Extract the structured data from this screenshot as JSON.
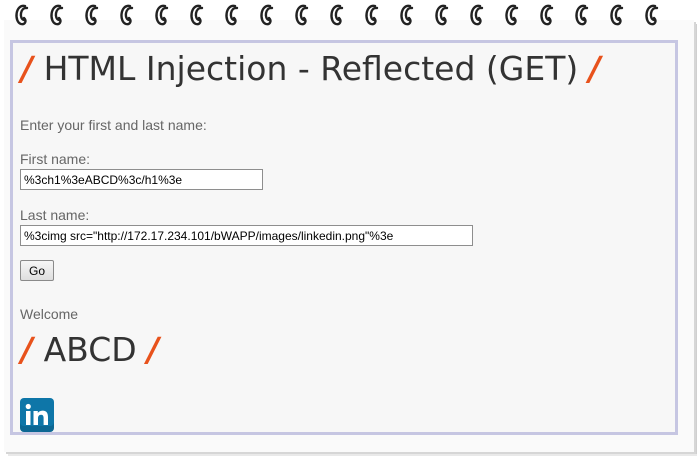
{
  "page": {
    "title": "HTML Injection - Reflected (GET)",
    "title_decor": "/"
  },
  "form": {
    "prompt": "Enter your first and last name:",
    "first_name_label": "First name:",
    "first_name_value": "%3ch1%3eABCD%3c/h1%3e",
    "last_name_label": "Last name:",
    "last_name_value": "%3cimg src=\"http://172.17.234.101/bWAPP/images/linkedin.png\"%3e",
    "submit_label": "Go"
  },
  "result": {
    "welcome": "Welcome",
    "heading": "ABCD",
    "image_icon": "linkedin-logo-icon"
  },
  "colors": {
    "accent": "#e8521c",
    "frame_border": "#c6c6e2",
    "linkedin_blue": "#0e76a8"
  }
}
